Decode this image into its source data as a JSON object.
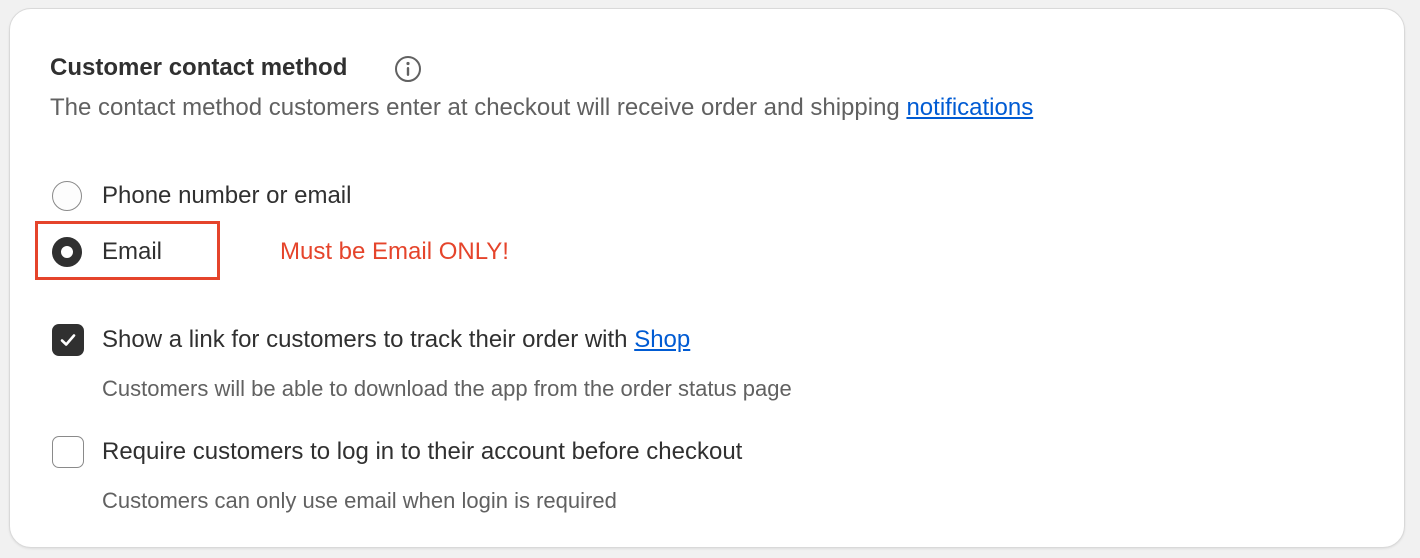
{
  "section": {
    "title": "Customer contact method",
    "description": "The contact method customers enter at checkout will receive order and shipping",
    "description_link": "notifications"
  },
  "contact_options": [
    {
      "label": "Phone number or email",
      "selected": false
    },
    {
      "label": "Email",
      "selected": true
    }
  ],
  "annotation": {
    "text": "Must be Email ONLY!",
    "color": "#e5442b"
  },
  "checkboxes": [
    {
      "label": "Show a link for customers to track their order with",
      "label_link": "Shop",
      "checked": true,
      "help": "Customers will be able to download the app from the order status page"
    },
    {
      "label": "Require customers to log in to their account before checkout",
      "checked": false,
      "help": "Customers can only use email when login is required"
    }
  ],
  "colors": {
    "link": "#005bd3",
    "text": "#303030",
    "subdued": "#616161",
    "accent": "#303030"
  },
  "icons": {
    "info": "info-circle-icon",
    "check": "checkmark-icon"
  }
}
